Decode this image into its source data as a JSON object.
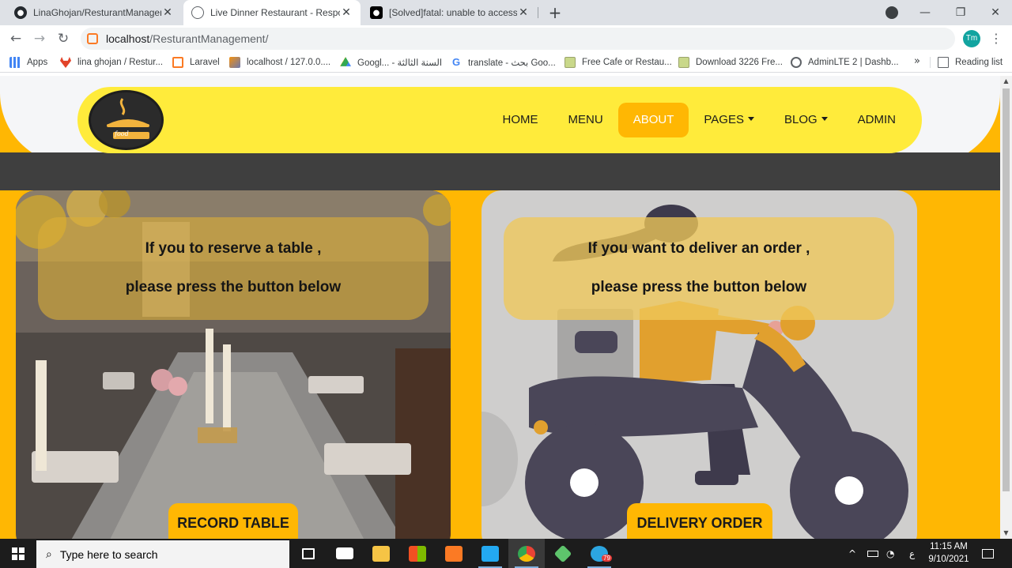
{
  "browser": {
    "tabs": [
      {
        "title": "LinaGhojan/ResturantManageme",
        "close": "✕",
        "favicon": "github-icon",
        "active": false
      },
      {
        "title": "Live Dinner Restaurant - Respons",
        "close": "✕",
        "favicon": "globe-icon",
        "active": true
      },
      {
        "title": "[Solved]fatal: unable to access : C",
        "close": "✕",
        "favicon": "medium-icon",
        "active": false
      }
    ],
    "new_tab": "+",
    "window_controls": {
      "minimize": "—",
      "maximize": "❐",
      "close": "✕"
    },
    "nav": {
      "back": "←",
      "forward": "→",
      "reload": "↻"
    },
    "address": {
      "host": "localhost",
      "path": "/ResturantManagement/"
    },
    "profile_initials": "Tm",
    "menu_glyph": "⋮",
    "bookmarks": [
      {
        "label": "Apps",
        "icon": "apps-grid-icon",
        "color": "#4285f4"
      },
      {
        "label": "lina ghojan / Restur...",
        "icon": "gitlab-icon",
        "color": "#e24329"
      },
      {
        "label": "Laravel",
        "icon": "xampp-icon",
        "color": "#fb7a24"
      },
      {
        "label": "localhost / 127.0.0....",
        "icon": "phpmyadmin-icon",
        "color": "#f29111"
      },
      {
        "label": "Googl... - السنة الثالثة",
        "icon": "google-drive-icon",
        "color": "#34a853"
      },
      {
        "label": "translate - بحث Goo...",
        "icon": "google-icon",
        "color": "#4285f4"
      },
      {
        "label": "Free Cafe or Restau...",
        "icon": "image-icon",
        "color": "#c9d88a"
      },
      {
        "label": "Download 3226 Fre...",
        "icon": "image-icon",
        "color": "#c9d88a"
      },
      {
        "label": "AdminLTE 2 | Dashb...",
        "icon": "globe-icon",
        "color": "#5f6368"
      }
    ],
    "bookmarks_more": "»",
    "reading_list": "Reading list"
  },
  "site": {
    "logo_text": "food",
    "nav_items": [
      {
        "label": "HOME",
        "active": false,
        "dropdown": false
      },
      {
        "label": "MENU",
        "active": false,
        "dropdown": false
      },
      {
        "label": "ABOUT",
        "active": true,
        "dropdown": false
      },
      {
        "label": "PAGES",
        "active": false,
        "dropdown": true
      },
      {
        "label": "BLOG",
        "active": false,
        "dropdown": true
      },
      {
        "label": "ADMIN",
        "active": false,
        "dropdown": false
      }
    ],
    "reserve_card": {
      "line1": "If you to reserve a table ,",
      "line2": "please press the button below",
      "button": "RECORD TABLE"
    },
    "delivery_card": {
      "line1": "If you want to deliver an order ,",
      "line2": "please press the button below",
      "button": "DELIVERY ORDER"
    }
  },
  "taskbar": {
    "search_placeholder": "Type here to search",
    "apps": [
      {
        "name": "task-view-icon",
        "color": "#ffffff"
      },
      {
        "name": "mail-icon",
        "color": "#ffffff"
      },
      {
        "name": "file-explorer-icon",
        "color": "#f6c445"
      },
      {
        "name": "store-icon",
        "color": "#ffffff"
      },
      {
        "name": "xampp-icon",
        "color": "#fb7a24"
      },
      {
        "name": "vscode-icon",
        "color": "#23a9f2"
      },
      {
        "name": "chrome-icon",
        "color": "#34a853"
      },
      {
        "name": "gitkraken-icon",
        "color": "#5ec46c"
      },
      {
        "name": "telegram-icon",
        "color": "#2ca5e0"
      }
    ],
    "telegram_badge": "79",
    "tray": {
      "chevron": "^",
      "lang": "ع"
    },
    "time": "11:15 AM",
    "date": "9/10/2021"
  }
}
